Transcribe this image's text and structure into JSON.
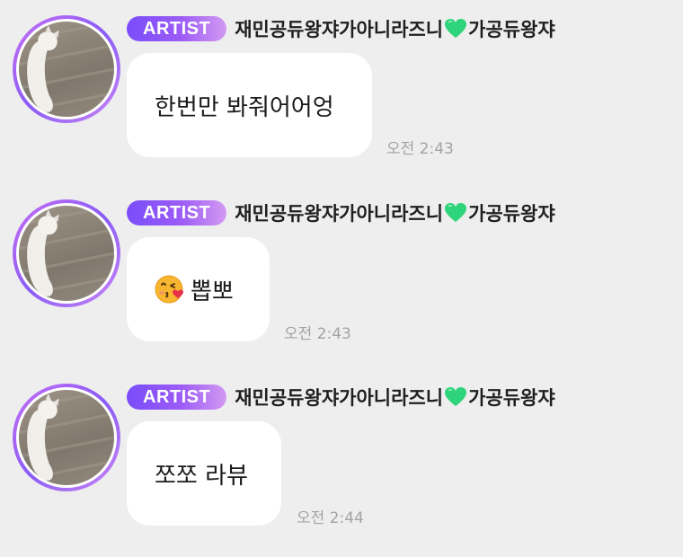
{
  "messages": [
    {
      "badge": "ARTIST",
      "sender_prefix": "재민공듀왕쟈가아니라즈니",
      "sender_heart": "green-heart-icon",
      "sender_suffix": "가공듀왕쟈",
      "text": "한번만 봐줘어어엉",
      "emoji": null,
      "time": "오전 2:43"
    },
    {
      "badge": "ARTIST",
      "sender_prefix": "재민공듀왕쟈가아니라즈니",
      "sender_heart": "green-heart-icon",
      "sender_suffix": "가공듀왕쟈",
      "text": "뽑뽀",
      "emoji": "kissing-face-blowing-heart-icon",
      "time": "오전 2:43"
    },
    {
      "badge": "ARTIST",
      "sender_prefix": "재민공듀왕쟈가아니라즈니",
      "sender_heart": "green-heart-icon",
      "sender_suffix": "가공듀왕쟈",
      "text": "쪼쪼 라뷰",
      "emoji": null,
      "time": "오전 2:44"
    }
  ],
  "colors": {
    "background": "#eeeeef",
    "badge_start": "#7a4dfa",
    "badge_end": "#d39af2",
    "avatar_ring": "#a860f5",
    "bubble": "#ffffff",
    "time_text": "#a3a3a3",
    "heart": "#2ed47a"
  }
}
